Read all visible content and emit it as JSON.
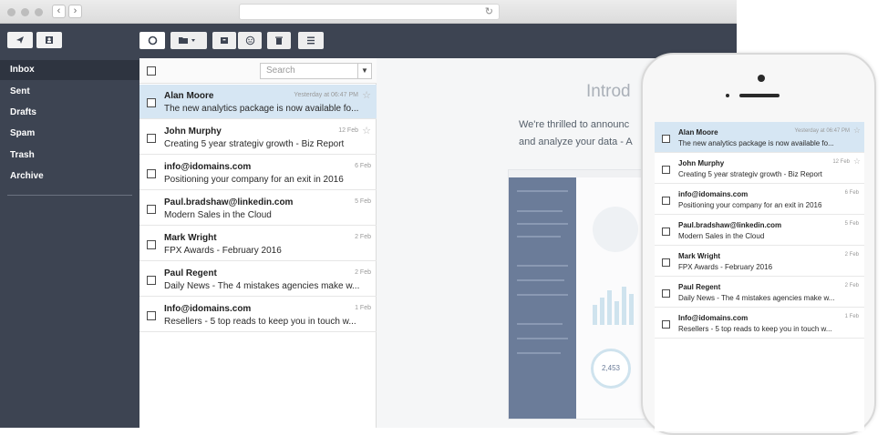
{
  "sidebar": {
    "compose_icon": "paper-plane-icon",
    "contacts_icon": "contact-card-icon",
    "items": [
      {
        "label": "Inbox",
        "active": true
      },
      {
        "label": "Sent"
      },
      {
        "label": "Drafts"
      },
      {
        "label": "Spam"
      },
      {
        "label": "Trash"
      },
      {
        "label": "Archive"
      }
    ]
  },
  "toolbar": {
    "refresh_icon": "refresh-circle-icon",
    "folder_icon": "folder-dropdown-icon",
    "archive_icon": "archive-box-icon",
    "spam_icon": "spam-face-icon",
    "delete_icon": "trash-icon",
    "menu_icon": "hamburger-menu-icon"
  },
  "search": {
    "placeholder": "Search"
  },
  "messages": [
    {
      "sender": "Alan Moore",
      "date": "Yesterday at 06:47 PM",
      "subject": "The new analytics package is now available fo...",
      "selected": true,
      "star": true
    },
    {
      "sender": "John Murphy",
      "date": "12 Feb",
      "subject": "Creating 5 year strategiv growth - Biz Report",
      "star": true
    },
    {
      "sender": "info@idomains.com",
      "date": "6 Feb",
      "subject": "Positioning your company for an exit in 2016"
    },
    {
      "sender": "Paul.bradshaw@linkedin.com",
      "date": "5 Feb",
      "subject": "Modern Sales in the Cloud"
    },
    {
      "sender": "Mark Wright",
      "date": "2 Feb",
      "subject": "FPX Awards - February 2016"
    },
    {
      "sender": "Paul Regent",
      "date": "2 Feb",
      "subject": "Daily News - The 4 mistakes agencies make w..."
    },
    {
      "sender": "Info@idomains.com",
      "date": "1 Feb",
      "subject": "Resellers - 5 top reads to keep you in touch w..."
    }
  ],
  "pane": {
    "title": "Introd",
    "line1": "We're thrilled to announc",
    "line2": "and analyze your data - A",
    "chart_value": "2,453"
  },
  "colors": {
    "sidebar": "#3d4452",
    "selected_row": "#d6e6f3"
  }
}
